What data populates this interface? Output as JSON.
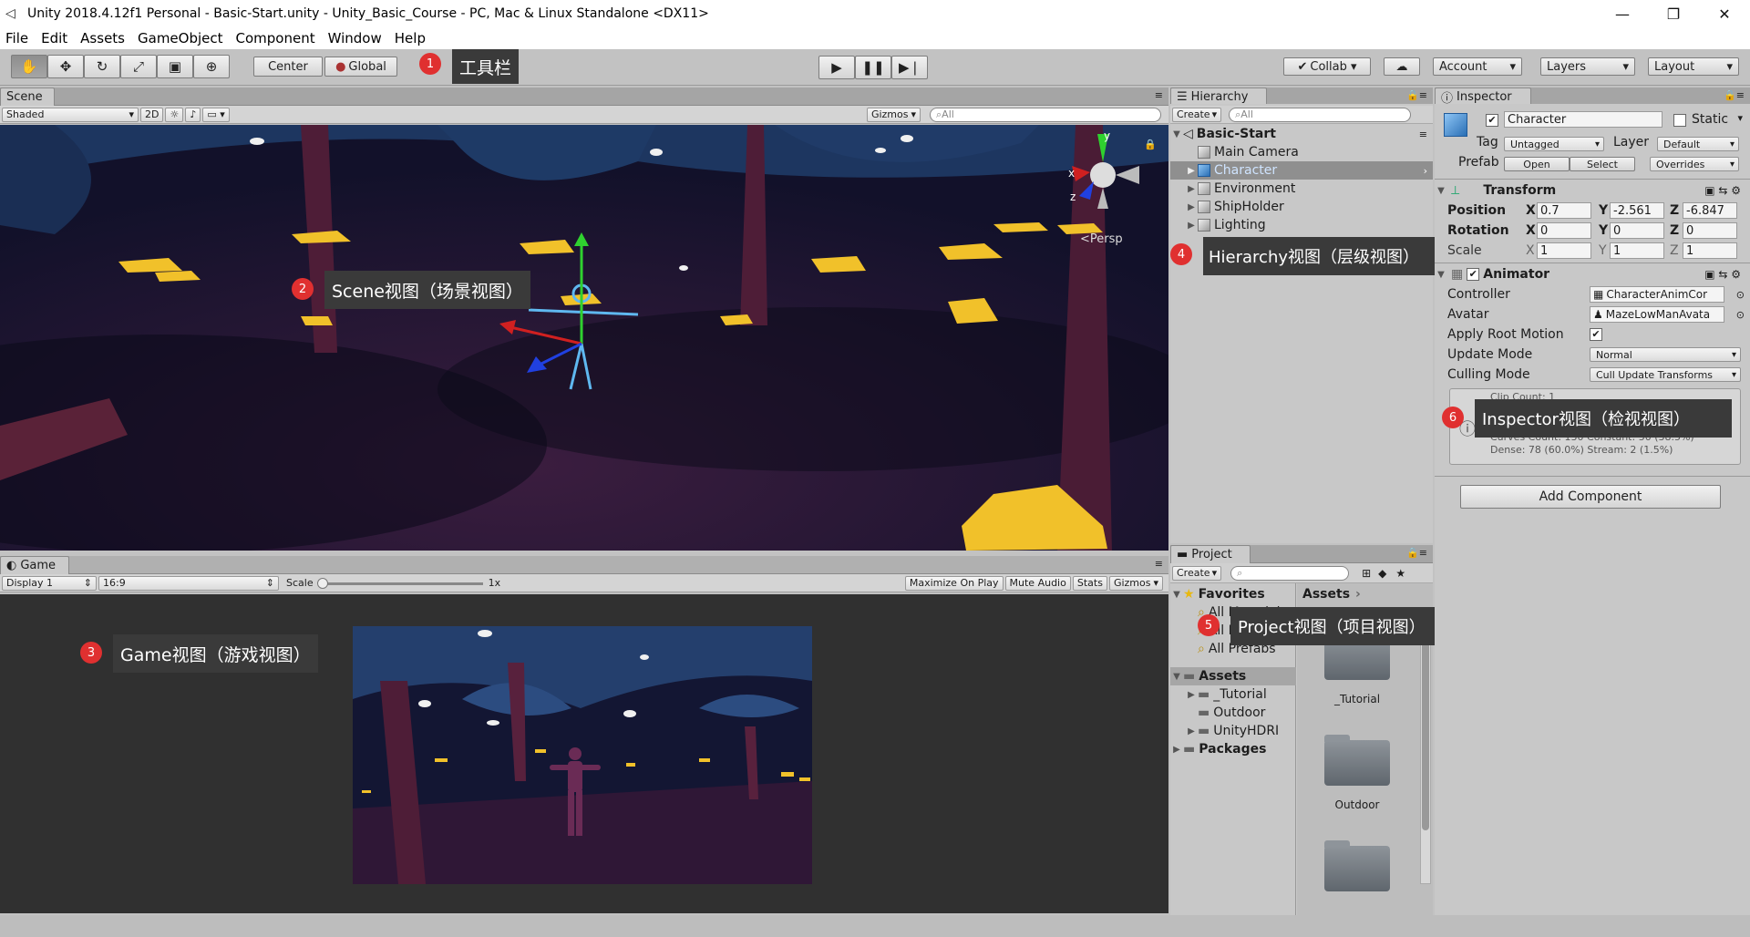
{
  "window": {
    "title": "Unity 2018.4.12f1 Personal - Basic-Start.unity - Unity_Basic_Course - PC, Mac & Linux Standalone <DX11>"
  },
  "menu": [
    "File",
    "Edit",
    "Assets",
    "GameObject",
    "Component",
    "Window",
    "Help"
  ],
  "toolbar": {
    "center_label": "Center",
    "global_label": "Global",
    "collab_label": "Collab ▾",
    "account_label": "Account",
    "layers_label": "Layers",
    "layout_label": "Layout"
  },
  "annotations": {
    "a1": {
      "num": "1",
      "text": "工具栏"
    },
    "a2": {
      "num": "2",
      "text": "Scene视图（场景视图）"
    },
    "a3": {
      "num": "3",
      "text": "Game视图（游戏视图）"
    },
    "a4": {
      "num": "4",
      "text": "Hierarchy视图（层级视图）"
    },
    "a5": {
      "num": "5",
      "text": "Project视图（项目视图）"
    },
    "a6": {
      "num": "6",
      "text": "Inspector视图（检视视图）"
    }
  },
  "scene": {
    "tab": "Scene",
    "shaded": "Shaded",
    "mode2d": "2D",
    "gizmos": "Gizmos",
    "search_placeholder": "All",
    "persp": "Persp",
    "axis_x": "x",
    "axis_y": "y",
    "axis_z": "z"
  },
  "game": {
    "tab": "Game",
    "display": "Display 1",
    "aspect": "16:9",
    "scale_label": "Scale",
    "scale_value": "1x",
    "maximize": "Maximize On Play",
    "mute": "Mute Audio",
    "stats": "Stats",
    "gizmos": "Gizmos"
  },
  "hierarchy": {
    "tab": "Hierarchy",
    "create": "Create",
    "search_placeholder": "All",
    "scene_name": "Basic-Start",
    "items": [
      {
        "label": "Main Camera"
      },
      {
        "label": "Character"
      },
      {
        "label": "Environment"
      },
      {
        "label": "ShipHolder"
      },
      {
        "label": "Lighting"
      }
    ]
  },
  "project": {
    "tab": "Project",
    "create": "Create",
    "favorites": "Favorites",
    "fav_items": [
      "All Materials",
      "All Models",
      "All Prefabs"
    ],
    "assets_header": "Assets",
    "assets_tree": [
      "Assets",
      "_Tutorial",
      "Outdoor",
      "UnityHDRI",
      "Packages"
    ],
    "breadcrumb": "Assets",
    "grid": [
      "_Tutorial",
      "Outdoor"
    ]
  },
  "inspector": {
    "tab": "Inspector",
    "object_name": "Character",
    "static_label": "Static",
    "tag_label": "Tag",
    "tag_value": "Untagged",
    "layer_label": "Layer",
    "layer_value": "Default",
    "prefab_label": "Prefab",
    "prefab_open": "Open",
    "prefab_select": "Select",
    "prefab_overrides": "Overrides",
    "transform": {
      "title": "Transform",
      "position": {
        "label": "Position",
        "x": "0.7",
        "y": "-2.561",
        "z": "-6.847"
      },
      "rotation": {
        "label": "Rotation",
        "x": "0",
        "y": "0",
        "z": "0"
      },
      "scale": {
        "label": "Scale",
        "x": "1",
        "y": "1",
        "z": "1"
      }
    },
    "animator": {
      "title": "Animator",
      "controller_label": "Controller",
      "controller_value": "CharacterAnimCor",
      "avatar_label": "Avatar",
      "avatar_value": "MazeLowManAvata",
      "root_motion_label": "Apply Root Motion",
      "update_mode_label": "Update Mode",
      "update_mode_value": "Normal",
      "culling_label": "Culling Mode",
      "culling_value": "Cull Update Transforms",
      "info_line1": "Clip Count: 1",
      "info_line2": "Curves Count: 130 Constant: 50 (38.5%)",
      "info_line3": "Dense: 78 (60.0%) Stream: 2 (1.5%)"
    },
    "add_component": "Add Component"
  },
  "colors": {
    "accent": "#e03030",
    "selection": "#8f8f8f",
    "scene_bg": "#10102a"
  }
}
